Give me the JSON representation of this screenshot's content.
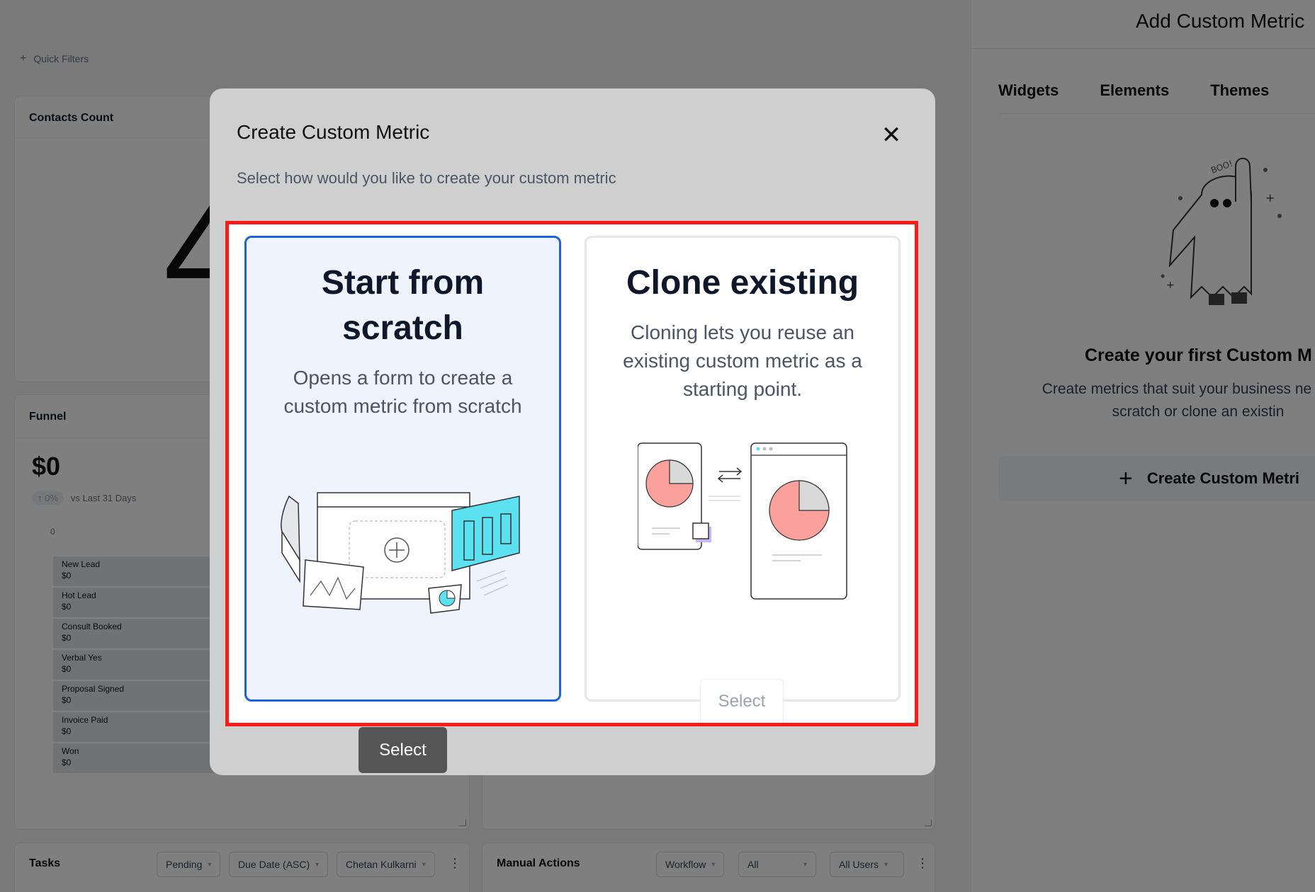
{
  "dashboard": {
    "quick_filters": "Quick Filters",
    "contacts": {
      "title": "Contacts Count",
      "value": "4"
    },
    "funnel": {
      "title": "Funnel",
      "amount": "$0",
      "change": "0%",
      "compare": "vs Last 31 Days",
      "axis_zero": "0",
      "stages": [
        {
          "name": "New Lead",
          "value": "$0"
        },
        {
          "name": "Hot Lead",
          "value": "$0"
        },
        {
          "name": "Consult Booked",
          "value": "$0"
        },
        {
          "name": "Verbal Yes",
          "value": "$0"
        },
        {
          "name": "Proposal Signed",
          "value": "$0"
        },
        {
          "name": "Invoice Paid",
          "value": "$0"
        },
        {
          "name": "Won",
          "value": "$0"
        }
      ]
    },
    "tasks": {
      "title": "Tasks",
      "filters": [
        "Pending",
        "Due Date (ASC)",
        "Chetan Kulkarni"
      ]
    },
    "manual_actions": {
      "title": "Manual Actions",
      "filters": [
        "Workflow",
        "All",
        "All Users"
      ]
    }
  },
  "panel": {
    "title": "Add Custom Metric",
    "tabs": [
      "Widgets",
      "Elements",
      "Themes"
    ],
    "ghost_text": "BOO!",
    "empty_title": "Create your first Custom M",
    "empty_desc_line1": "Create metrics that suit your business ne",
    "empty_desc_line2": "scratch or clone an existin",
    "create_button": "Create Custom Metri"
  },
  "modal": {
    "title": "Create Custom Metric",
    "subtitle": "Select how would you like to create your custom metric",
    "options": [
      {
        "title_line1": "Start from",
        "title_line2": "scratch",
        "description": "Opens a form to create a custom metric from scratch",
        "button": "Select"
      },
      {
        "title": "Clone existing",
        "description": "Cloning lets you reuse an existing custom metric as a starting point.",
        "button": "Select"
      }
    ]
  },
  "colors": {
    "selected_border": "#1d63d8",
    "selected_bg": "#eef3fe",
    "highlight": "#ff1a1a",
    "pie_red": "#f9a19a",
    "pie_gray": "#d9d9d9",
    "cyan": "#5ce1f0"
  }
}
